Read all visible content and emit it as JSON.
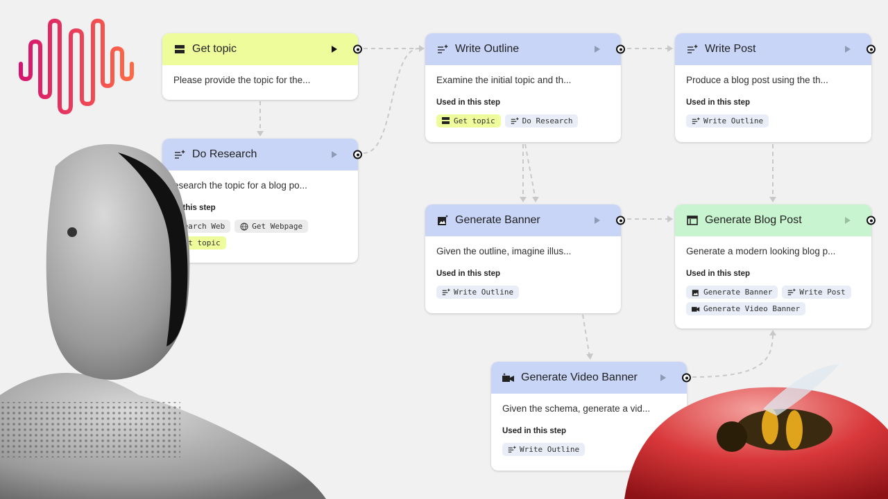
{
  "used_label": "Used in this step",
  "nodes": {
    "get_topic": {
      "title": "Get topic",
      "desc": "Please provide the topic for the..."
    },
    "do_research": {
      "title": "Do Research",
      "desc": "esearch the topic for a blog po...",
      "used_label": "in this step",
      "chips": [
        "Search Web",
        "Get Webpage",
        "Get topic"
      ]
    },
    "write_outline": {
      "title": "Write Outline",
      "desc": "Examine the initial topic and th...",
      "chips": [
        "Get topic",
        "Do Research"
      ]
    },
    "write_post": {
      "title": "Write Post",
      "desc": "Produce a blog post using the th...",
      "chips": [
        "Write Outline"
      ]
    },
    "generate_banner": {
      "title": "Generate Banner",
      "desc": "Given the outline, imagine illus...",
      "chips": [
        "Write Outline"
      ]
    },
    "generate_blog_post": {
      "title": "Generate Blog Post",
      "desc": "Generate a modern looking blog p...",
      "chips": [
        "Generate Banner",
        "Write Post",
        "Generate Video Banner"
      ]
    },
    "generate_video_banner": {
      "title": "Generate Video Banner",
      "desc": "Given the schema, generate a vid...",
      "chips": [
        "Write Outline"
      ]
    }
  },
  "colors": {
    "input_header": "#eefc9c",
    "generate_header": "#c8d5f7",
    "output_header": "#c8f5cf",
    "wire": "#c8c8c8"
  },
  "icons": {
    "input": "input-icon",
    "generate": "sparkle-lines-icon",
    "image": "image-sparkle-icon",
    "video": "video-sparkle-icon",
    "output": "web-layout-icon",
    "web": "globe-icon"
  }
}
